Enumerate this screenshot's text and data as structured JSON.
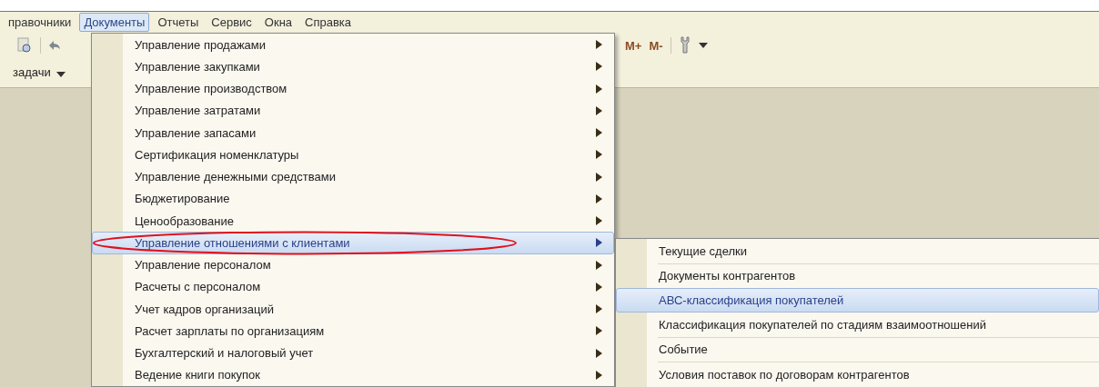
{
  "menu_bar": [
    {
      "label": "правочники",
      "selected": false
    },
    {
      "label": "Документы",
      "selected": true
    },
    {
      "label": "Отчеты",
      "selected": false
    },
    {
      "label": "Сервис",
      "selected": false
    },
    {
      "label": "Окна",
      "selected": false
    },
    {
      "label": "Справка",
      "selected": false
    }
  ],
  "toolbar": {
    "task_label": "задачи",
    "memory_buttons": [
      "M+",
      "M-"
    ]
  },
  "documents_menu": {
    "items": [
      {
        "label": "Управление продажами",
        "selected": false,
        "has_submenu": true,
        "circled": false
      },
      {
        "label": "Управление закупками",
        "selected": false,
        "has_submenu": true,
        "circled": false
      },
      {
        "label": "Управление производством",
        "selected": false,
        "has_submenu": true,
        "circled": false
      },
      {
        "label": "Управление затратами",
        "selected": false,
        "has_submenu": true,
        "circled": false
      },
      {
        "label": "Управление запасами",
        "selected": false,
        "has_submenu": true,
        "circled": false
      },
      {
        "label": "Сертификация номенклатуры",
        "selected": false,
        "has_submenu": true,
        "circled": false
      },
      {
        "label": "Управление денежными средствами",
        "selected": false,
        "has_submenu": true,
        "circled": false
      },
      {
        "label": "Бюджетирование",
        "selected": false,
        "has_submenu": true,
        "circled": false
      },
      {
        "label": "Ценообразование",
        "selected": false,
        "has_submenu": true,
        "circled": false
      },
      {
        "label": "Управление отношениями с клиентами",
        "selected": true,
        "has_submenu": true,
        "circled": true
      },
      {
        "label": "Управление персоналом",
        "selected": false,
        "has_submenu": true,
        "circled": false
      },
      {
        "label": "Расчеты с персоналом",
        "selected": false,
        "has_submenu": true,
        "circled": false
      },
      {
        "label": "Учет кадров организаций",
        "selected": false,
        "has_submenu": true,
        "circled": false
      },
      {
        "label": "Расчет зарплаты по организациям",
        "selected": false,
        "has_submenu": true,
        "circled": false
      },
      {
        "label": "Бухгалтерский и налоговый учет",
        "selected": false,
        "has_submenu": true,
        "circled": false
      },
      {
        "label": "Ведение книги покупок",
        "selected": false,
        "has_submenu": true,
        "circled": false
      }
    ]
  },
  "submenu": {
    "items": [
      {
        "label": "Текущие сделки",
        "selected": false,
        "separator_after": true
      },
      {
        "label": "Документы контрагентов",
        "selected": false,
        "separator_after": false
      },
      {
        "label": "АВС-классификация покупателей",
        "selected": true,
        "separator_after": false
      },
      {
        "label": "Классификация покупателей по стадиям взаимоотношений",
        "selected": false,
        "separator_after": true
      },
      {
        "label": "Событие",
        "selected": false,
        "separator_after": true
      },
      {
        "label": "Условия поставок по договорам контрагентов",
        "selected": false,
        "separator_after": false
      }
    ]
  }
}
